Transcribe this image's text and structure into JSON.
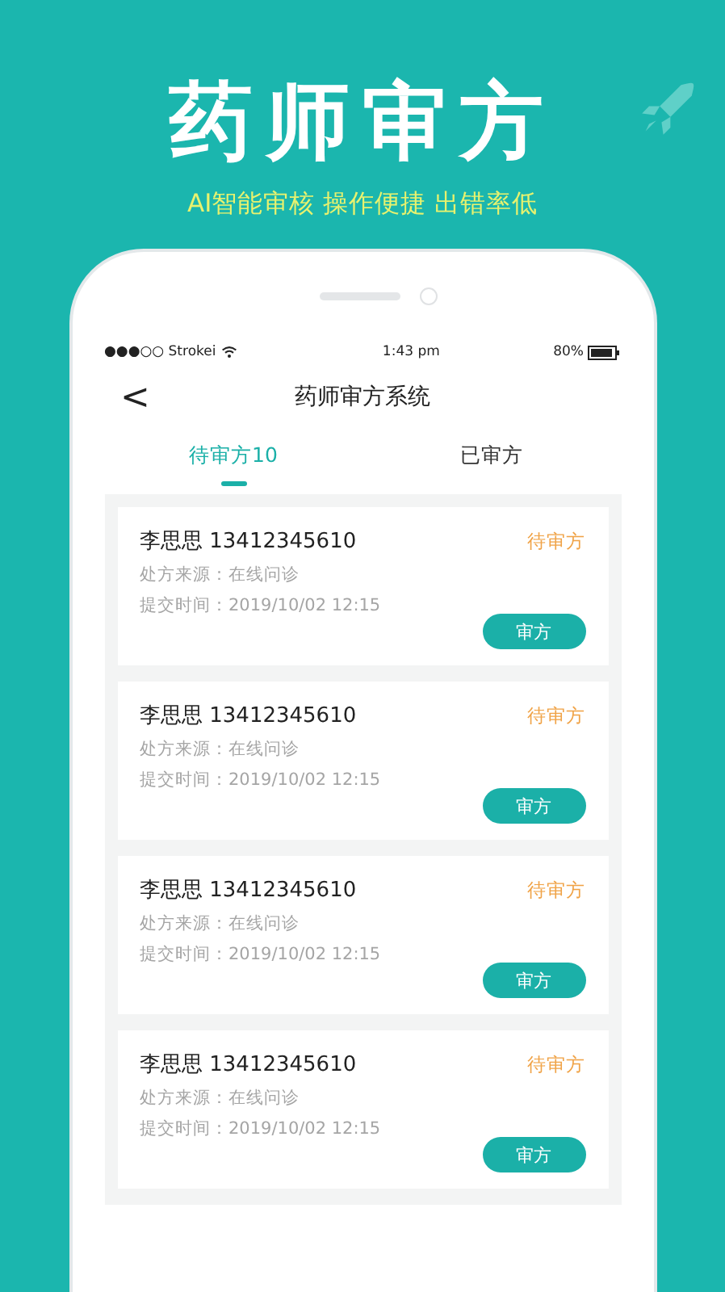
{
  "headline": "药师审方",
  "tagline": "AI智能审核 操作便捷 出错率低",
  "status_bar": {
    "carrier": "●●●○○ Strokei",
    "time": "1:43 pm",
    "battery": "80%"
  },
  "nav": {
    "back": "<",
    "title": "药师审方系统"
  },
  "tabs": [
    {
      "label": "待审方10",
      "selected": true
    },
    {
      "label": "已审方",
      "selected": false
    }
  ],
  "cards": [
    {
      "name": "李思思 13412345610",
      "status": "待审方",
      "source": "处方来源：在线问诊",
      "time": "提交时间：2019/10/02 12:15",
      "button": "审方"
    },
    {
      "name": "李思思 13412345610",
      "status": "待审方",
      "source": "处方来源：在线问诊",
      "time": "提交时间：2019/10/02 12:15",
      "button": "审方"
    },
    {
      "name": "李思思 13412345610",
      "status": "待审方",
      "source": "处方来源：在线问诊",
      "time": "提交时间：2019/10/02 12:15",
      "button": "审方"
    },
    {
      "name": "李思思 13412345610",
      "status": "待审方",
      "source": "处方来源：在线问诊",
      "time": "提交时间：2019/10/02 12:15",
      "button": "审方"
    }
  ]
}
